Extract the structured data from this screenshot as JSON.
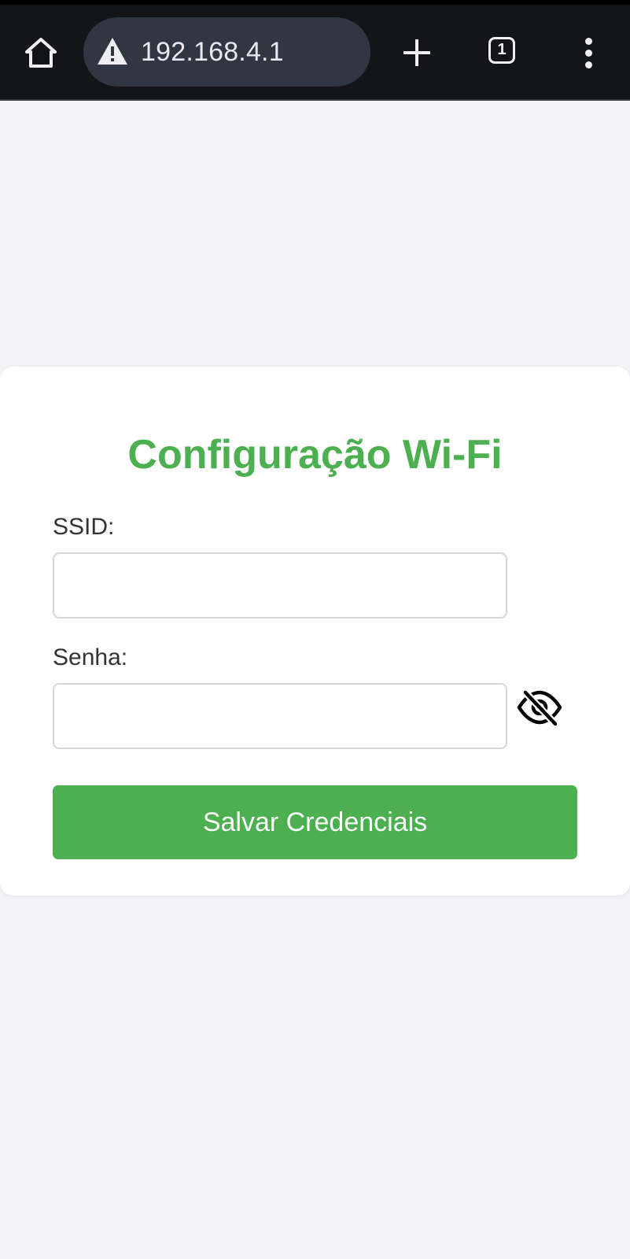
{
  "browser": {
    "url": "192.168.4.1",
    "tab_count": "1",
    "icons": {
      "home": "home-icon",
      "security": "warning-triangle-icon",
      "new_tab": "plus-icon",
      "tabs": "tab-switcher-icon",
      "menu": "vertical-dots-icon"
    },
    "colors": {
      "toolbar": "#141519",
      "url_pill": "#313643",
      "icon": "#f0f0f4"
    }
  },
  "page": {
    "title": "Configuração Wi-Fi",
    "form": {
      "ssid_label": "SSID:",
      "ssid_value": "",
      "password_label": "Senha:",
      "password_value": "",
      "password_toggle_icon": "eye-slash-icon",
      "submit_label": "Salvar Credenciais"
    },
    "colors": {
      "accent": "#4caf50",
      "background": "#f2f2f7",
      "card": "#ffffff"
    }
  }
}
